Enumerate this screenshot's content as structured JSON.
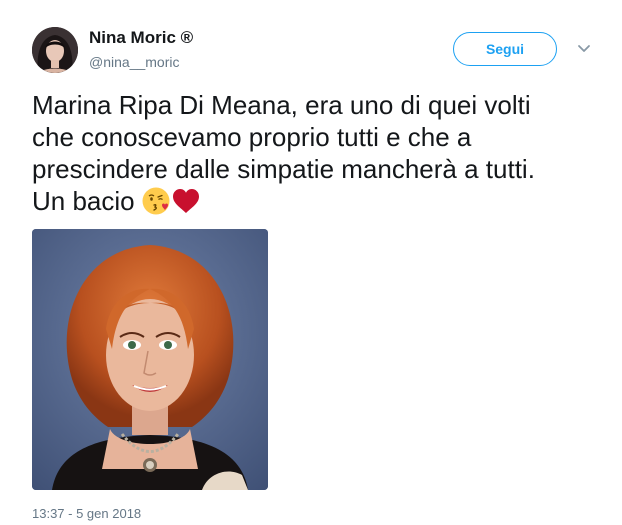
{
  "author": {
    "display_name": "Nina Moric ®",
    "username": "@nina__moric"
  },
  "actions": {
    "follow_label": "Segui",
    "more_icon": "chevron-down-icon"
  },
  "tweet": {
    "lines": [
      "Marina Ripa Di Meana, era uno di quei volti",
      "che conoscevamo proprio tutti e che a",
      "prescindere dalle simpatie mancherà a tutti.",
      "Un bacio"
    ],
    "emojis": [
      "face-blowing-kiss-emoji",
      "red-heart-emoji"
    ]
  },
  "timestamp": "13:37 - 5 gen 2018",
  "colors": {
    "accent": "#1da1f2",
    "secondary_text": "#657786",
    "primary_text": "#14171a"
  }
}
